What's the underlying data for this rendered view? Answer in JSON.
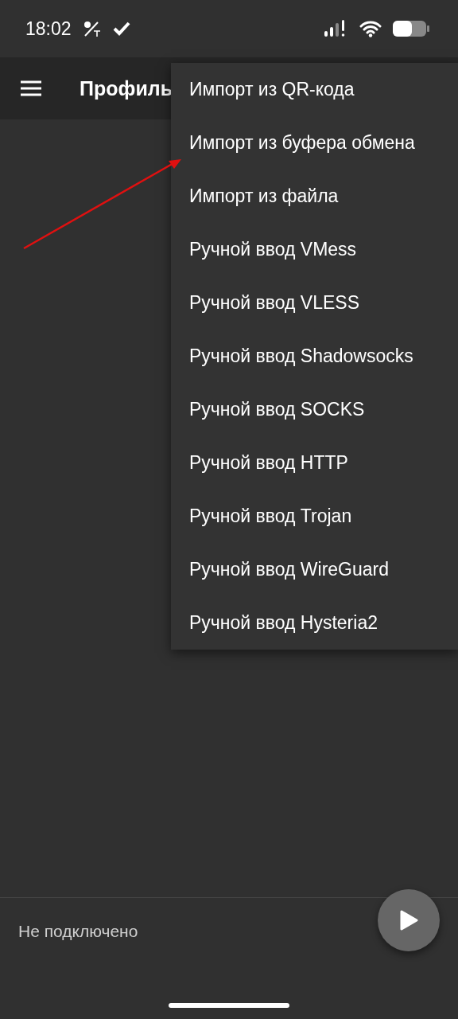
{
  "status_bar": {
    "time": "18:02"
  },
  "app_bar": {
    "title": "Профиль"
  },
  "menu": {
    "items": [
      {
        "label": "Импорт из QR-кода"
      },
      {
        "label": "Импорт из буфера обмена"
      },
      {
        "label": "Импорт из файла"
      },
      {
        "label": "Ручной ввод VMess"
      },
      {
        "label": "Ручной ввод VLESS"
      },
      {
        "label": "Ручной ввод Shadowsocks"
      },
      {
        "label": "Ручной ввод SOCKS"
      },
      {
        "label": "Ручной ввод HTTP"
      },
      {
        "label": "Ручной ввод Trojan"
      },
      {
        "label": "Ручной ввод WireGuard"
      },
      {
        "label": "Ручной ввод Hysteria2"
      }
    ]
  },
  "footer": {
    "status": "Не подключено"
  }
}
